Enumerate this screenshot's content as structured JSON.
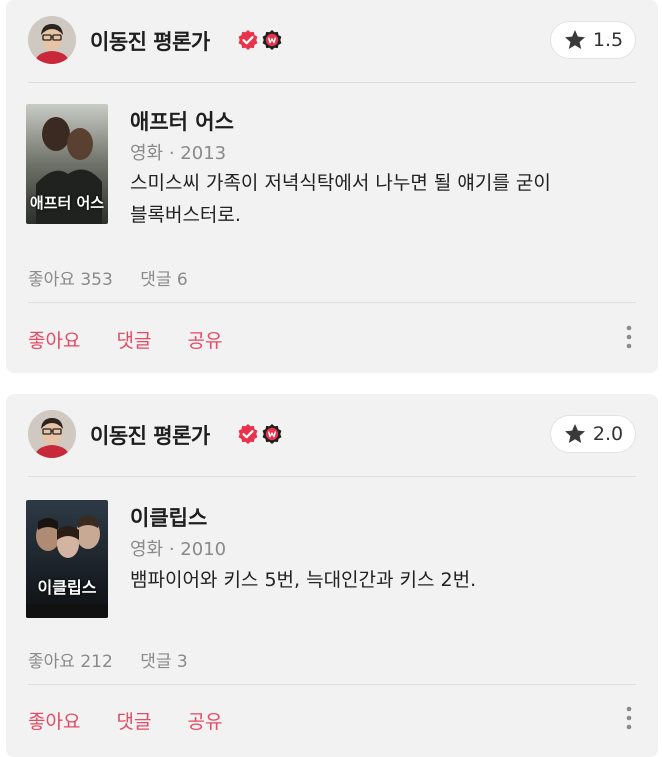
{
  "reviews": [
    {
      "user": {
        "name": "이동진 평론가",
        "avatar_icon": "avatar-photo",
        "verified_icon": "verified-check-icon",
        "badge_icon": "w-badge-icon"
      },
      "rating": "1.5",
      "movie": {
        "title": "애프터 어스",
        "meta": "영화 · 2013",
        "poster_title": "애프터 어스"
      },
      "review_lines": [
        "스미스씨 가족이 저녁식탁에서 나누면 될 얘기를 굳이",
        "블록버스터로."
      ],
      "likes": "좋아요 353",
      "comments": "댓글 6",
      "actions": {
        "like": "좋아요",
        "comment": "댓글",
        "share": "공유"
      }
    },
    {
      "user": {
        "name": "이동진 평론가",
        "avatar_icon": "avatar-photo",
        "verified_icon": "verified-check-icon",
        "badge_icon": "w-badge-icon"
      },
      "rating": "2.0",
      "movie": {
        "title": "이클립스",
        "meta": "영화 · 2010",
        "poster_title": "이클립스"
      },
      "review_lines": [
        "뱀파이어와 키스 5번, 늑대인간과 키스 2번."
      ],
      "likes": "좋아요 212",
      "comments": "댓글 3",
      "actions": {
        "like": "좋아요",
        "comment": "댓글",
        "share": "공유"
      }
    }
  ],
  "colors": {
    "accent": "#e34b66",
    "badge_red": "#e8334a",
    "card_bg": "#f2f2f3"
  }
}
